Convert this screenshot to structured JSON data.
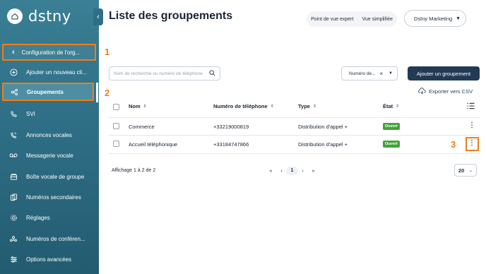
{
  "brand": {
    "name": "dstny",
    "logo_icon": "home-icon"
  },
  "sidebar": {
    "org_config_label": "Configuration de l'org...",
    "items": [
      {
        "label": "Ajouter un nouveau cli...",
        "icon": "plus-circle-icon"
      },
      {
        "label": "Groupements",
        "icon": "group-icon"
      },
      {
        "label": "SVI",
        "icon": "phone-ivr-icon"
      },
      {
        "label": "Annonces vocales",
        "icon": "announcement-icon"
      },
      {
        "label": "Messagerie vocale",
        "icon": "voicemail-icon"
      },
      {
        "label": "Boîte vocale de groupe",
        "icon": "group-voicemail-icon"
      },
      {
        "label": "Numéros secondaires",
        "icon": "secondary-number-icon"
      },
      {
        "label": "Réglages",
        "icon": "settings-icon"
      },
      {
        "label": "Numéros de conféren...",
        "icon": "conference-icon"
      },
      {
        "label": "Options avancées",
        "icon": "advanced-options-icon"
      }
    ]
  },
  "annotations": [
    "1",
    "2",
    "3"
  ],
  "header": {
    "title": "Liste des groupements",
    "view_expert": "Point de vue expert",
    "view_simple": "Vue simplifiée",
    "org_selected": "Dstny Marketing"
  },
  "toolbar": {
    "search_placeholder": "Nom de recherche ou numéro de téléphone",
    "filter_value": "Numéro de...",
    "add_button": "Ajouter un groupement",
    "export_label": "Exporter vers CSV"
  },
  "table": {
    "columns": [
      "Nom",
      "Numéro de téléphone",
      "Type",
      "État"
    ],
    "rows": [
      {
        "name": "Commerce",
        "phone": "+33219000819",
        "type": "Distribution d'appel +",
        "state": "Ouvert"
      },
      {
        "name": "Accueil téléphonique",
        "phone": "+33184747866",
        "type": "Distribution d'appel +",
        "state": "Ouvert"
      }
    ]
  },
  "pagination": {
    "summary": "Affichage 1 à 2 de 2",
    "current_page": "1",
    "per_page": "20"
  },
  "colors": {
    "accent": "#f07d1a",
    "sidebar": "#2e6f86",
    "primary_button": "#233a55",
    "status_open": "#45a23b"
  }
}
